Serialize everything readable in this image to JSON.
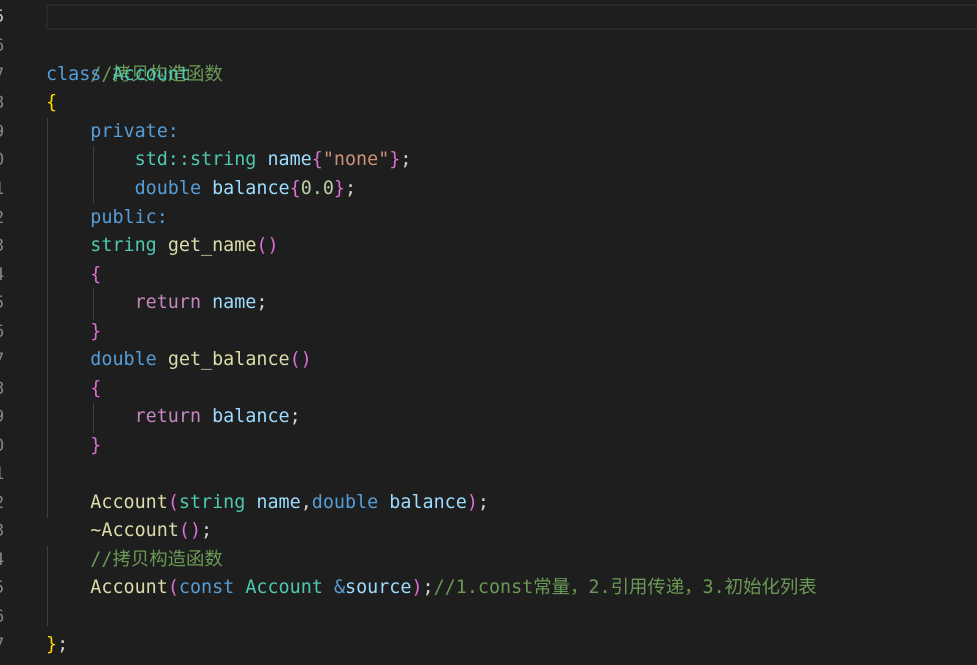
{
  "line_numbers": [
    "5",
    "6",
    "7",
    "8",
    "9",
    "0",
    "1",
    "2",
    "3",
    "4",
    "5",
    "6",
    "7",
    "8",
    "9",
    "0",
    "1",
    "2",
    "3",
    "4",
    "5",
    "6",
    "7"
  ],
  "code": {
    "l06_comment": "//拷贝构造函数",
    "l07_class_kw": "class",
    "l07_class_name": "Account",
    "l08_open": "{",
    "l09_private": "private:",
    "l10_std": "std::string",
    "l10_var": "name",
    "l10_open": "{",
    "l10_str": "\"none\"",
    "l10_close": "}",
    "l10_semi": ";",
    "l11_type": "double",
    "l11_var": "balance",
    "l11_open": "{",
    "l11_num": "0.0",
    "l11_close": "}",
    "l11_semi": ";",
    "l12_public": "public:",
    "l13_type": "string",
    "l13_fn": "get_name",
    "l13_parens": "()",
    "l14_open": "{",
    "l15_return": "return",
    "l15_var": "name",
    "l15_semi": ";",
    "l16_close": "}",
    "l17_type": "double",
    "l17_fn": "get_balance",
    "l17_parens": "()",
    "l18_open": "{",
    "l19_return": "return",
    "l19_var": "balance",
    "l19_semi": ";",
    "l20_close": "}",
    "l22_fn": "Account",
    "l22_lp": "(",
    "l22_t1": "string",
    "l22_p1": "name",
    "l22_comma": ",",
    "l22_t2": "double",
    "l22_p2": "balance",
    "l22_rp": ")",
    "l22_semi": ";",
    "l23_fn": "~Account",
    "l23_parens": "()",
    "l23_semi": ";",
    "l24_comment": "//拷贝构造函数",
    "l25_fn": "Account",
    "l25_lp": "(",
    "l25_const": "const",
    "l25_type": "Account",
    "l25_amp": "&",
    "l25_var": "source",
    "l25_rp": ")",
    "l25_semi": ";",
    "l25_comment": "//1.const常量，2.引用传递，3.初始化列表",
    "l27_close": "}",
    "l27_semi": ";"
  },
  "colors": {
    "background": "#1e1e1e",
    "comment": "#6a9955",
    "keyword": "#569cd6",
    "control_keyword": "#c586c0",
    "type": "#4ec9b0",
    "function": "#dcdcaa",
    "variable": "#9cdcfe",
    "string": "#ce9178",
    "number": "#b5cea8",
    "bracket_level1": "#ffd700",
    "bracket_level2": "#da70d6",
    "bracket_level3": "#179fff"
  }
}
